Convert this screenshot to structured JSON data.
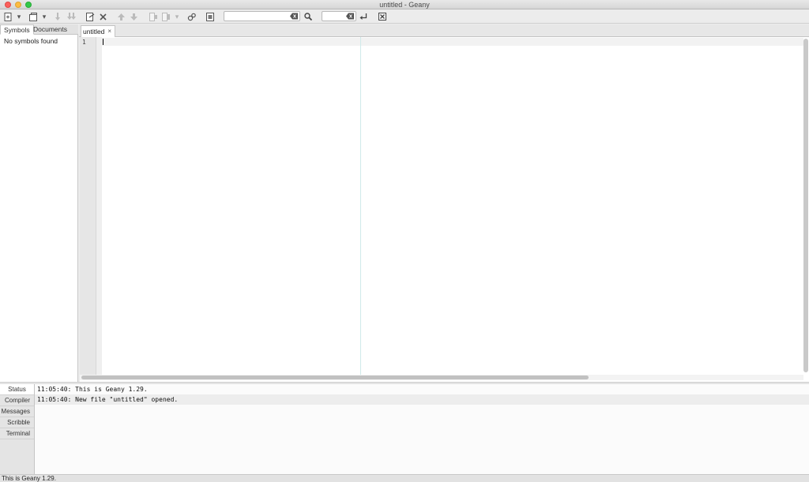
{
  "window": {
    "title": "untitled - Geany"
  },
  "toolbar": {
    "search_value": "",
    "goto_line_value": ""
  },
  "sidebar": {
    "tabs": [
      {
        "label": "Symbols",
        "active": true
      },
      {
        "label": "Documents",
        "active": false
      }
    ],
    "empty_text": "No symbols found"
  },
  "editor": {
    "tabs": [
      {
        "label": "untitled",
        "close": "×"
      }
    ],
    "line_numbers": [
      "1"
    ]
  },
  "messages": {
    "tabs": [
      {
        "label": "Status",
        "active": true
      },
      {
        "label": "Compiler",
        "active": false
      },
      {
        "label": "Messages",
        "active": false
      },
      {
        "label": "Scribble",
        "active": false
      },
      {
        "label": "Terminal",
        "active": false
      }
    ],
    "lines": [
      "11:05:40: This is Geany 1.29.",
      "11:05:40: New file \"untitled\" opened."
    ]
  },
  "statusbar": {
    "text": "This is Geany 1.29."
  },
  "colors": {
    "close": "#fc605c",
    "minimize": "#fdbc40",
    "maximize": "#34c84a",
    "long_line_marker": "#cfeaea"
  }
}
